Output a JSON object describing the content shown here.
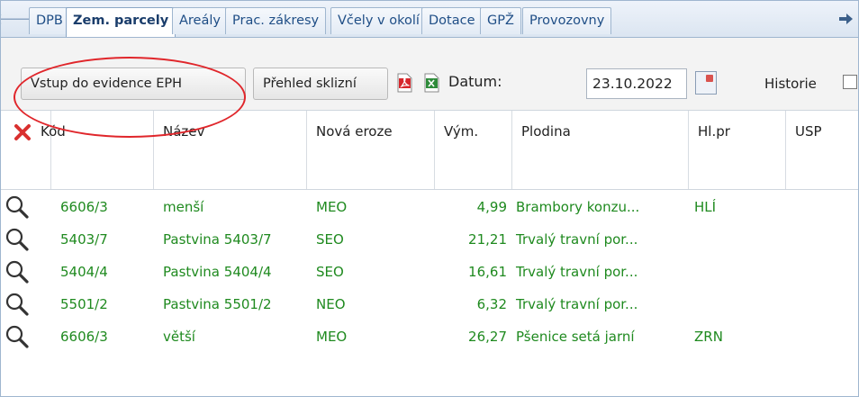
{
  "tabs": {
    "items": [
      {
        "label": "DPB"
      },
      {
        "label": "Zem. parcely"
      },
      {
        "label": "Areály"
      },
      {
        "label": "Prac. zákresy"
      },
      {
        "label": "Včely v okolí"
      },
      {
        "label": "Dotace"
      },
      {
        "label": "GPŽ"
      },
      {
        "label": "Provozovny"
      }
    ],
    "active_index": 1
  },
  "toolbar": {
    "btn_evidence": "Vstup do evidence EPH",
    "btn_harvest": "Přehled sklizní",
    "date_label": "Datum:",
    "date_value": "23.10.2022",
    "history_label": "Historie"
  },
  "grid": {
    "columns": [
      "Kód",
      "Název",
      "Nová eroze",
      "Vým.",
      "Plodina",
      "Hl.pr",
      "USP"
    ],
    "rows": [
      {
        "kod": "6606/3",
        "nazev": "menší",
        "eroze": "MEO",
        "vym": "4,99",
        "plodina": "Brambory konzu...",
        "hlpr": "HLÍ",
        "usp": ""
      },
      {
        "kod": "5403/7",
        "nazev": "Pastvina 5403/7",
        "eroze": "SEO",
        "vym": "21,21",
        "plodina": "Trvalý travní por...",
        "hlpr": "",
        "usp": ""
      },
      {
        "kod": "5404/4",
        "nazev": "Pastvina 5404/4",
        "eroze": "SEO",
        "vym": "16,61",
        "plodina": "Trvalý travní por...",
        "hlpr": "",
        "usp": ""
      },
      {
        "kod": "5501/2",
        "nazev": "Pastvina 5501/2",
        "eroze": "NEO",
        "vym": "6,32",
        "plodina": "Trvalý travní por...",
        "hlpr": "",
        "usp": ""
      },
      {
        "kod": "6606/3",
        "nazev": "větší",
        "eroze": "MEO",
        "vym": "26,27",
        "plodina": "Pšenice setá jarní",
        "hlpr": "ZRN",
        "usp": ""
      }
    ]
  },
  "colors": {
    "data_text": "#1f8a1f",
    "tab_text": "#1f4e86",
    "highlight_ellipse": "#e0262b"
  },
  "icons": [
    "arrow-left-icon",
    "arrow-right-icon",
    "pdf-icon",
    "excel-icon",
    "calendar-icon",
    "delete-filter-icon",
    "magnifier-icon"
  ]
}
